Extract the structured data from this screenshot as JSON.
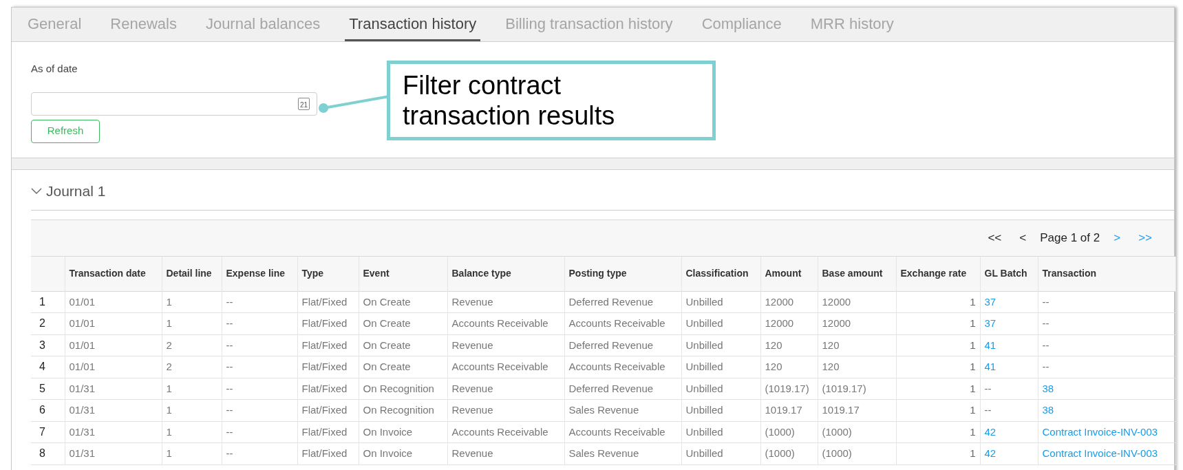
{
  "tabs": [
    {
      "label": "General",
      "selected": false
    },
    {
      "label": "Renewals",
      "selected": false
    },
    {
      "label": "Journal balances",
      "selected": false
    },
    {
      "label": "Transaction history",
      "selected": true
    },
    {
      "label": "Billing transaction history",
      "selected": false
    },
    {
      "label": "Compliance",
      "selected": false
    },
    {
      "label": "MRR history",
      "selected": false
    }
  ],
  "filter": {
    "label": "As of date",
    "calendar_day": "21",
    "button": "Refresh"
  },
  "callout": {
    "text": "Filter contract transaction results"
  },
  "journal": {
    "title": "Journal 1",
    "expanded": true,
    "pagination": [
      {
        "label": "<<",
        "disabled": true
      },
      {
        "label": "<",
        "disabled": true
      },
      {
        "label": "Page 1 of 2",
        "kind": "status"
      },
      {
        "label": ">",
        "disabled": false
      },
      {
        "label": ">>",
        "disabled": false
      }
    ],
    "columns": [
      "Transaction date",
      "Detail line",
      "Expense line",
      "Type",
      "Event",
      "Balance type",
      "Posting type",
      "Classification",
      "Amount",
      "Base amount",
      "Exchange rate",
      "GL Batch",
      "Transaction"
    ],
    "rows": [
      {
        "number": "1",
        "cells": [
          {
            "text": "01/01",
            "kind": "text"
          },
          {
            "text": "1",
            "kind": "text"
          },
          {
            "text": "--",
            "kind": "text"
          },
          {
            "text": "Flat/Fixed",
            "kind": "text"
          },
          {
            "text": "On Create",
            "kind": "text"
          },
          {
            "text": "Revenue",
            "kind": "text"
          },
          {
            "text": "Deferred Revenue",
            "kind": "text"
          },
          {
            "text": "Unbilled",
            "kind": "text"
          },
          {
            "text": "12000",
            "kind": "text"
          },
          {
            "text": "12000",
            "kind": "text"
          },
          {
            "text": "1",
            "kind": "number"
          },
          {
            "text": "37",
            "kind": "link"
          },
          {
            "text": "--",
            "kind": "text"
          }
        ]
      },
      {
        "number": "2",
        "cells": [
          {
            "text": "01/01",
            "kind": "text"
          },
          {
            "text": "1",
            "kind": "text"
          },
          {
            "text": "--",
            "kind": "text"
          },
          {
            "text": "Flat/Fixed",
            "kind": "text"
          },
          {
            "text": "On Create",
            "kind": "text"
          },
          {
            "text": "Accounts Receivable",
            "kind": "text"
          },
          {
            "text": "Accounts Receivable",
            "kind": "text"
          },
          {
            "text": "Unbilled",
            "kind": "text"
          },
          {
            "text": "12000",
            "kind": "text"
          },
          {
            "text": "12000",
            "kind": "text"
          },
          {
            "text": "1",
            "kind": "number"
          },
          {
            "text": "37",
            "kind": "link"
          },
          {
            "text": "--",
            "kind": "text"
          }
        ]
      },
      {
        "number": "3",
        "cells": [
          {
            "text": "01/01",
            "kind": "text"
          },
          {
            "text": "2",
            "kind": "text"
          },
          {
            "text": "--",
            "kind": "text"
          },
          {
            "text": "Flat/Fixed",
            "kind": "text"
          },
          {
            "text": "On Create",
            "kind": "text"
          },
          {
            "text": "Revenue",
            "kind": "text"
          },
          {
            "text": "Deferred Revenue",
            "kind": "text"
          },
          {
            "text": "Unbilled",
            "kind": "text"
          },
          {
            "text": "120",
            "kind": "text"
          },
          {
            "text": "120",
            "kind": "text"
          },
          {
            "text": "1",
            "kind": "number"
          },
          {
            "text": "41",
            "kind": "link"
          },
          {
            "text": "--",
            "kind": "text"
          }
        ]
      },
      {
        "number": "4",
        "cells": [
          {
            "text": "01/01",
            "kind": "text"
          },
          {
            "text": "2",
            "kind": "text"
          },
          {
            "text": "--",
            "kind": "text"
          },
          {
            "text": "Flat/Fixed",
            "kind": "text"
          },
          {
            "text": "On Create",
            "kind": "text"
          },
          {
            "text": "Accounts Receivable",
            "kind": "text"
          },
          {
            "text": "Accounts Receivable",
            "kind": "text"
          },
          {
            "text": "Unbilled",
            "kind": "text"
          },
          {
            "text": "120",
            "kind": "text"
          },
          {
            "text": "120",
            "kind": "text"
          },
          {
            "text": "1",
            "kind": "number"
          },
          {
            "text": "41",
            "kind": "link"
          },
          {
            "text": "--",
            "kind": "text"
          }
        ]
      },
      {
        "number": "5",
        "cells": [
          {
            "text": "01/31",
            "kind": "text"
          },
          {
            "text": "1",
            "kind": "text"
          },
          {
            "text": "--",
            "kind": "text"
          },
          {
            "text": "Flat/Fixed",
            "kind": "text"
          },
          {
            "text": "On Recognition",
            "kind": "text"
          },
          {
            "text": "Revenue",
            "kind": "text"
          },
          {
            "text": "Deferred Revenue",
            "kind": "text"
          },
          {
            "text": "Unbilled",
            "kind": "text"
          },
          {
            "text": "(1019.17)",
            "kind": "text"
          },
          {
            "text": "(1019.17)",
            "kind": "text"
          },
          {
            "text": "1",
            "kind": "number"
          },
          {
            "text": "--",
            "kind": "text"
          },
          {
            "text": "38",
            "kind": "link"
          }
        ]
      },
      {
        "number": "6",
        "cells": [
          {
            "text": "01/31",
            "kind": "text"
          },
          {
            "text": "1",
            "kind": "text"
          },
          {
            "text": "--",
            "kind": "text"
          },
          {
            "text": "Flat/Fixed",
            "kind": "text"
          },
          {
            "text": "On Recognition",
            "kind": "text"
          },
          {
            "text": "Revenue",
            "kind": "text"
          },
          {
            "text": "Sales Revenue",
            "kind": "text"
          },
          {
            "text": "Unbilled",
            "kind": "text"
          },
          {
            "text": "1019.17",
            "kind": "text"
          },
          {
            "text": "1019.17",
            "kind": "text"
          },
          {
            "text": "1",
            "kind": "number"
          },
          {
            "text": "--",
            "kind": "text"
          },
          {
            "text": "38",
            "kind": "link"
          }
        ]
      },
      {
        "number": "7",
        "cells": [
          {
            "text": "01/31",
            "kind": "text"
          },
          {
            "text": "1",
            "kind": "text"
          },
          {
            "text": "--",
            "kind": "text"
          },
          {
            "text": "Flat/Fixed",
            "kind": "text"
          },
          {
            "text": "On Invoice",
            "kind": "text"
          },
          {
            "text": "Accounts Receivable",
            "kind": "text"
          },
          {
            "text": "Accounts Receivable",
            "kind": "text"
          },
          {
            "text": "Unbilled",
            "kind": "text"
          },
          {
            "text": "(1000)",
            "kind": "text"
          },
          {
            "text": "(1000)",
            "kind": "text"
          },
          {
            "text": "1",
            "kind": "number"
          },
          {
            "text": "42",
            "kind": "link"
          },
          {
            "text": "Contract Invoice-INV-003",
            "kind": "link"
          }
        ]
      },
      {
        "number": "8",
        "cells": [
          {
            "text": "01/31",
            "kind": "text"
          },
          {
            "text": "1",
            "kind": "text"
          },
          {
            "text": "--",
            "kind": "text"
          },
          {
            "text": "Flat/Fixed",
            "kind": "text"
          },
          {
            "text": "On Invoice",
            "kind": "text"
          },
          {
            "text": "Revenue",
            "kind": "text"
          },
          {
            "text": "Sales Revenue",
            "kind": "text"
          },
          {
            "text": "Unbilled",
            "kind": "text"
          },
          {
            "text": "(1000)",
            "kind": "text"
          },
          {
            "text": "(1000)",
            "kind": "text"
          },
          {
            "text": "1",
            "kind": "number"
          },
          {
            "text": "42",
            "kind": "link"
          },
          {
            "text": "Contract Invoice-INV-003",
            "kind": "link"
          }
        ]
      }
    ]
  }
}
